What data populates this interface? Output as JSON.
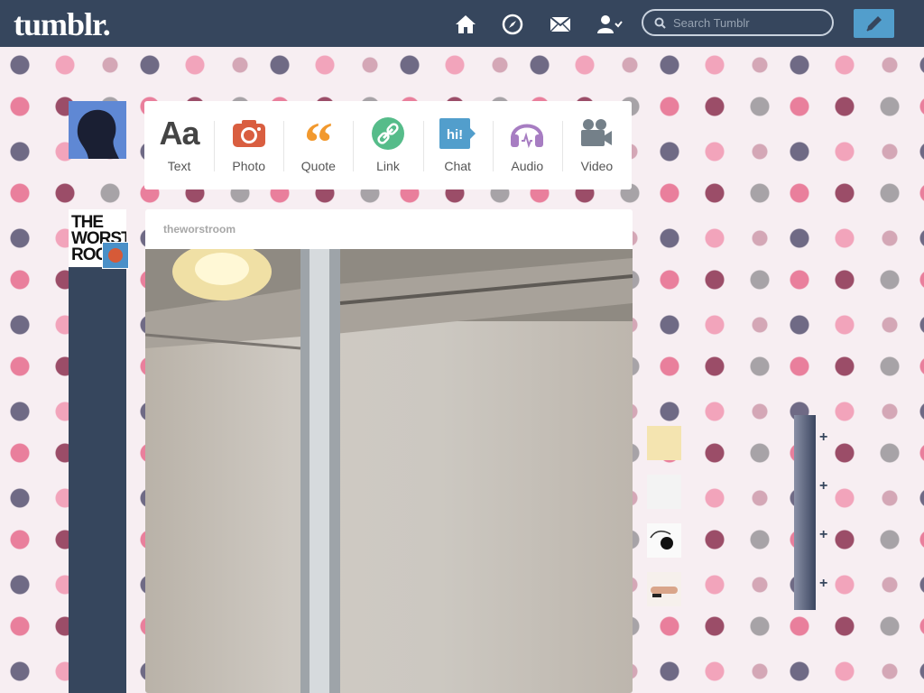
{
  "header": {
    "logo": "tumblr.",
    "search_placeholder": "Search Tumblr",
    "nav": [
      {
        "icon": "home-icon"
      },
      {
        "icon": "explore-icon"
      },
      {
        "icon": "inbox-icon"
      },
      {
        "icon": "account-icon"
      }
    ],
    "compose_icon": "pencil-icon"
  },
  "post_types": [
    {
      "label": "Text",
      "icon": "text-icon",
      "color": "#444444"
    },
    {
      "label": "Photo",
      "icon": "camera-icon",
      "color": "#d95e40"
    },
    {
      "label": "Quote",
      "icon": "quote-icon",
      "color": "#f2992e"
    },
    {
      "label": "Link",
      "icon": "link-icon",
      "color": "#56bc8a"
    },
    {
      "label": "Chat",
      "icon": "chat-icon",
      "color": "#529ecc"
    },
    {
      "label": "Audio",
      "icon": "headphones-icon",
      "color": "#a77dc2"
    },
    {
      "label": "Video",
      "icon": "video-camera-icon",
      "color": "#748089"
    }
  ],
  "post": {
    "author": "theworstroom",
    "avatar_text": "THE WORST ROO"
  },
  "recommended": [
    {
      "thumb": "food-thumb",
      "follow": "+"
    },
    {
      "thumb": "text-thumb",
      "follow": "+"
    },
    {
      "thumb": "sketch-thumb",
      "follow": "+"
    },
    {
      "thumb": "hand-thumb",
      "follow": "+"
    }
  ]
}
